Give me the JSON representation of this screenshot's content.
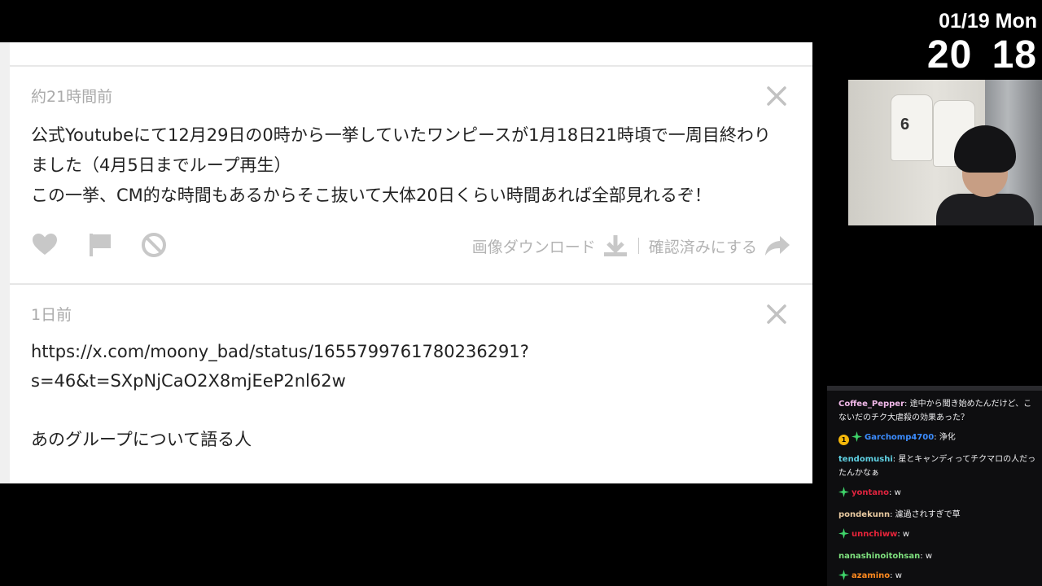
{
  "clock": {
    "date": "01/19 Mon",
    "time": "20 18"
  },
  "webcam": {
    "jersey_number": "6"
  },
  "feed": {
    "posts": [
      {
        "time_ago": "約21時間前",
        "text_lines": [
          "公式Youtubeにて12月29日の0時から一挙していたワンピースが1月18日21時頃で一周目終わり",
          "ました（4月5日までループ再生）",
          "この一挙、CM的な時間もあるからそこ抜いて大体20日くらい時間あれば全部見れるぞ！"
        ],
        "download_label": "画像ダウンロード",
        "confirm_label": "確認済みにする"
      },
      {
        "time_ago": "1日前",
        "text_lines": [
          "https://x.com/moony_bad/status/1655799761780236291?",
          "s=46&t=SXpNjCaO2X8mjEeP2nl62w",
          "",
          "あのグループについて語る人"
        ]
      }
    ]
  },
  "chat": {
    "messages": [
      {
        "user": "Coffee_Pepper",
        "color": "#f0b8e8",
        "sep": ": ",
        "text": "途中から聞き始めたんだけど、こないだのチク大虐殺の効果あった？",
        "badges": []
      },
      {
        "user": "Garchomp4700",
        "color": "#3c8dff",
        "sep": ": ",
        "text": "浄化",
        "badges": [
          "sub",
          "star"
        ],
        "sub_badge": "1"
      },
      {
        "user": "tendomushi",
        "color": "#5fd1e3",
        "sep": ": ",
        "text": "星とキャンディってチクマロの人だったんかなぁ",
        "badges": []
      },
      {
        "user": "yontano",
        "color": "#e0243f",
        "sep": ": ",
        "text": "w",
        "badges": [
          "star"
        ]
      },
      {
        "user": "pondekunn",
        "color": "#e8c9a0",
        "sep": ": ",
        "text": "濾過されすぎで草",
        "badges": []
      },
      {
        "user": "unnchiww",
        "color": "#e8243a",
        "sep": ": ",
        "text": "w",
        "badges": [
          "star"
        ]
      },
      {
        "user": "nanashinoitohsan",
        "color": "#7ee07e",
        "sep": ": ",
        "text": "w",
        "badges": []
      },
      {
        "user": "azamino",
        "color": "#ff8a1f",
        "sep": ": ",
        "text": "w",
        "badges": [
          "star"
        ]
      }
    ]
  },
  "colors": {
    "star_badge": "#3fd46a",
    "sub_badge": "#f5b70a",
    "icon_gray": "#c8c8c8"
  }
}
